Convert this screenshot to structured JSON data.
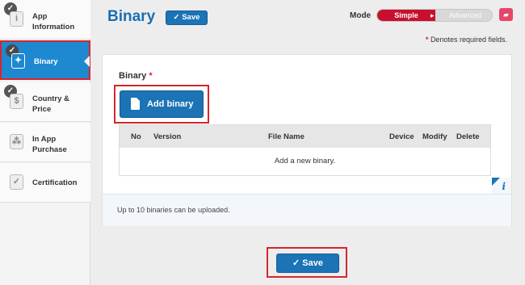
{
  "sidebar": {
    "items": [
      {
        "label_line1": "App",
        "label_line2": "Information",
        "icon": "info-icon",
        "glyph": "i",
        "checked": true
      },
      {
        "label_line1": "Binary",
        "label_line2": "",
        "icon": "binary-icon",
        "glyph": "✦",
        "checked": true,
        "active": true
      },
      {
        "label_line1": "Country &",
        "label_line2": "Price",
        "icon": "dollar-icon",
        "glyph": "$",
        "checked": true
      },
      {
        "label_line1": "In App",
        "label_line2": "Purchase",
        "icon": "in-app-icon",
        "glyph": "⁂",
        "checked": false
      },
      {
        "label_line1": "Certification",
        "label_line2": "",
        "icon": "shield-icon",
        "glyph": "✓",
        "checked": false
      }
    ]
  },
  "header": {
    "title": "Binary",
    "save_label": "Save",
    "mode_label": "Mode",
    "mode_simple": "Simple",
    "mode_advanced": "Advanced"
  },
  "required_note": {
    "star": "*",
    "text": "Denotes required fields."
  },
  "binary_section": {
    "label": "Binary",
    "required_star": "*",
    "add_button_label": "Add binary"
  },
  "table": {
    "columns": [
      "No",
      "Version",
      "File Name",
      "Device",
      "Modify",
      "Delete"
    ],
    "empty_message": "Add a new binary."
  },
  "note": "Up to 10 binaries can be uploaded.",
  "footer": {
    "save_label": "Save"
  },
  "colors": {
    "accent": "#1c73b5",
    "active_sidebar": "#1e88d1",
    "mode_simple": "#c8102e",
    "highlight": "#d6262e"
  }
}
